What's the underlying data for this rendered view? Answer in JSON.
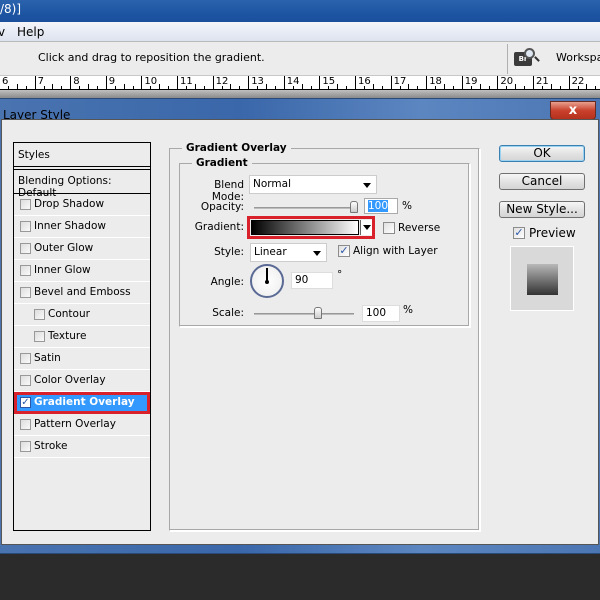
{
  "app": {
    "title_fragment": "/8)]",
    "menu": [
      {
        "label": "v"
      },
      {
        "label": "Help"
      }
    ],
    "options_bar": {
      "hint": "Click and drag to reposition the gradient.",
      "bridge_icon_label": "Br",
      "workspace_label": "Workspace"
    },
    "ruler": {
      "labels": [
        "6",
        "7",
        "8",
        "9",
        "10",
        "11",
        "12",
        "13",
        "14",
        "15",
        "16",
        "17",
        "18",
        "19",
        "20",
        "21",
        "22"
      ]
    }
  },
  "dialog": {
    "title": "Layer Style",
    "close_label": "x",
    "styles_header": "Styles",
    "blending_options": "Blending Options: Default",
    "effects": [
      {
        "label": "Drop Shadow",
        "checked": false,
        "indent": false,
        "selected": false
      },
      {
        "label": "Inner Shadow",
        "checked": false,
        "indent": false,
        "selected": false
      },
      {
        "label": "Outer Glow",
        "checked": false,
        "indent": false,
        "selected": false
      },
      {
        "label": "Inner Glow",
        "checked": false,
        "indent": false,
        "selected": false
      },
      {
        "label": "Bevel and Emboss",
        "checked": false,
        "indent": false,
        "selected": false
      },
      {
        "label": "Contour",
        "checked": false,
        "indent": true,
        "selected": false
      },
      {
        "label": "Texture",
        "checked": false,
        "indent": true,
        "selected": false
      },
      {
        "label": "Satin",
        "checked": false,
        "indent": false,
        "selected": false
      },
      {
        "label": "Color Overlay",
        "checked": false,
        "indent": false,
        "selected": false
      },
      {
        "label": "Gradient Overlay",
        "checked": true,
        "indent": false,
        "selected": true
      },
      {
        "label": "Pattern Overlay",
        "checked": false,
        "indent": false,
        "selected": false
      },
      {
        "label": "Stroke",
        "checked": false,
        "indent": false,
        "selected": false
      }
    ],
    "panel": {
      "section_title": "Gradient Overlay",
      "group_title": "Gradient",
      "blend_mode_label": "Blend Mode:",
      "blend_mode_value": "Normal",
      "opacity_label": "Opacity:",
      "opacity_value": "100",
      "opacity_percent": 100,
      "opacity_unit": "%",
      "gradient_label": "Gradient:",
      "gradient_colors": [
        "#000000",
        "#ffffff"
      ],
      "reverse_label": "Reverse",
      "reverse_checked": false,
      "style_label": "Style:",
      "style_value": "Linear",
      "align_label": "Align with Layer",
      "align_checked": true,
      "angle_label": "Angle:",
      "angle_value": "90",
      "angle_unit": "°",
      "scale_label": "Scale:",
      "scale_value": "100",
      "scale_percent": 100,
      "scale_unit": "%"
    },
    "buttons": {
      "ok": "OK",
      "cancel": "Cancel",
      "new_style": "New Style..."
    },
    "preview_label": "Preview",
    "preview_checked": true,
    "highlight_color": "#d9212c",
    "selection_color": "#3399ff"
  }
}
